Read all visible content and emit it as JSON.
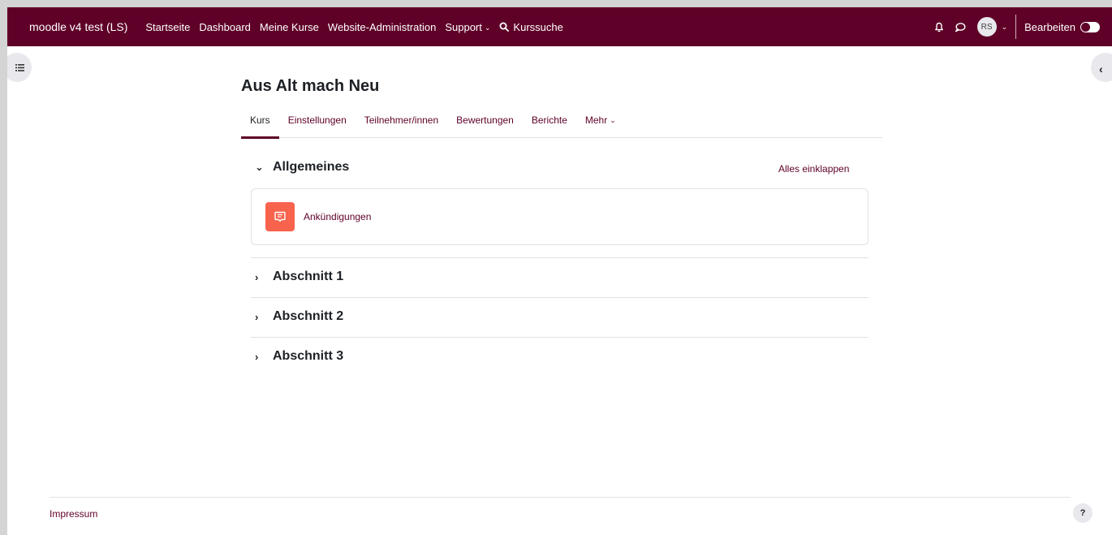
{
  "navbar": {
    "brand": "moodle v4 test (LS)",
    "links": [
      "Startseite",
      "Dashboard",
      "Meine Kurse",
      "Website-Administration"
    ],
    "support_label": "Support",
    "search_label": "Kurssuche",
    "avatar_initials": "RS",
    "edit_label": "Bearbeiten",
    "bg_color": "#5f0028"
  },
  "course": {
    "title": "Aus Alt mach Neu",
    "tabs": [
      "Kurs",
      "Einstellungen",
      "Teilnehmer/innen",
      "Bewertungen",
      "Berichte"
    ],
    "more_label": "Mehr",
    "collapse_all": "Alles einklappen"
  },
  "sections": [
    {
      "title": "Allgemeines",
      "expanded": true,
      "activities": [
        {
          "name": "Ankündigungen",
          "icon": "forum-icon",
          "color": "#f7634d"
        }
      ]
    },
    {
      "title": "Abschnitt 1",
      "expanded": false
    },
    {
      "title": "Abschnitt 2",
      "expanded": false
    },
    {
      "title": "Abschnitt 3",
      "expanded": false
    }
  ],
  "footer": {
    "link": "Impressum",
    "help": "?"
  }
}
